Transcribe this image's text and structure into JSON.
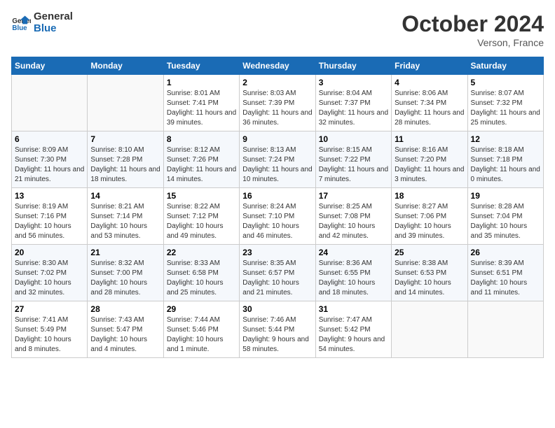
{
  "logo": {
    "line1": "General",
    "line2": "Blue"
  },
  "title": "October 2024",
  "location": "Verson, France",
  "days_header": [
    "Sunday",
    "Monday",
    "Tuesday",
    "Wednesday",
    "Thursday",
    "Friday",
    "Saturday"
  ],
  "weeks": [
    [
      {
        "day": "",
        "info": ""
      },
      {
        "day": "",
        "info": ""
      },
      {
        "day": "1",
        "info": "Sunrise: 8:01 AM\nSunset: 7:41 PM\nDaylight: 11 hours and 39 minutes."
      },
      {
        "day": "2",
        "info": "Sunrise: 8:03 AM\nSunset: 7:39 PM\nDaylight: 11 hours and 36 minutes."
      },
      {
        "day": "3",
        "info": "Sunrise: 8:04 AM\nSunset: 7:37 PM\nDaylight: 11 hours and 32 minutes."
      },
      {
        "day": "4",
        "info": "Sunrise: 8:06 AM\nSunset: 7:34 PM\nDaylight: 11 hours and 28 minutes."
      },
      {
        "day": "5",
        "info": "Sunrise: 8:07 AM\nSunset: 7:32 PM\nDaylight: 11 hours and 25 minutes."
      }
    ],
    [
      {
        "day": "6",
        "info": "Sunrise: 8:09 AM\nSunset: 7:30 PM\nDaylight: 11 hours and 21 minutes."
      },
      {
        "day": "7",
        "info": "Sunrise: 8:10 AM\nSunset: 7:28 PM\nDaylight: 11 hours and 18 minutes."
      },
      {
        "day": "8",
        "info": "Sunrise: 8:12 AM\nSunset: 7:26 PM\nDaylight: 11 hours and 14 minutes."
      },
      {
        "day": "9",
        "info": "Sunrise: 8:13 AM\nSunset: 7:24 PM\nDaylight: 11 hours and 10 minutes."
      },
      {
        "day": "10",
        "info": "Sunrise: 8:15 AM\nSunset: 7:22 PM\nDaylight: 11 hours and 7 minutes."
      },
      {
        "day": "11",
        "info": "Sunrise: 8:16 AM\nSunset: 7:20 PM\nDaylight: 11 hours and 3 minutes."
      },
      {
        "day": "12",
        "info": "Sunrise: 8:18 AM\nSunset: 7:18 PM\nDaylight: 11 hours and 0 minutes."
      }
    ],
    [
      {
        "day": "13",
        "info": "Sunrise: 8:19 AM\nSunset: 7:16 PM\nDaylight: 10 hours and 56 minutes."
      },
      {
        "day": "14",
        "info": "Sunrise: 8:21 AM\nSunset: 7:14 PM\nDaylight: 10 hours and 53 minutes."
      },
      {
        "day": "15",
        "info": "Sunrise: 8:22 AM\nSunset: 7:12 PM\nDaylight: 10 hours and 49 minutes."
      },
      {
        "day": "16",
        "info": "Sunrise: 8:24 AM\nSunset: 7:10 PM\nDaylight: 10 hours and 46 minutes."
      },
      {
        "day": "17",
        "info": "Sunrise: 8:25 AM\nSunset: 7:08 PM\nDaylight: 10 hours and 42 minutes."
      },
      {
        "day": "18",
        "info": "Sunrise: 8:27 AM\nSunset: 7:06 PM\nDaylight: 10 hours and 39 minutes."
      },
      {
        "day": "19",
        "info": "Sunrise: 8:28 AM\nSunset: 7:04 PM\nDaylight: 10 hours and 35 minutes."
      }
    ],
    [
      {
        "day": "20",
        "info": "Sunrise: 8:30 AM\nSunset: 7:02 PM\nDaylight: 10 hours and 32 minutes."
      },
      {
        "day": "21",
        "info": "Sunrise: 8:32 AM\nSunset: 7:00 PM\nDaylight: 10 hours and 28 minutes."
      },
      {
        "day": "22",
        "info": "Sunrise: 8:33 AM\nSunset: 6:58 PM\nDaylight: 10 hours and 25 minutes."
      },
      {
        "day": "23",
        "info": "Sunrise: 8:35 AM\nSunset: 6:57 PM\nDaylight: 10 hours and 21 minutes."
      },
      {
        "day": "24",
        "info": "Sunrise: 8:36 AM\nSunset: 6:55 PM\nDaylight: 10 hours and 18 minutes."
      },
      {
        "day": "25",
        "info": "Sunrise: 8:38 AM\nSunset: 6:53 PM\nDaylight: 10 hours and 14 minutes."
      },
      {
        "day": "26",
        "info": "Sunrise: 8:39 AM\nSunset: 6:51 PM\nDaylight: 10 hours and 11 minutes."
      }
    ],
    [
      {
        "day": "27",
        "info": "Sunrise: 7:41 AM\nSunset: 5:49 PM\nDaylight: 10 hours and 8 minutes."
      },
      {
        "day": "28",
        "info": "Sunrise: 7:43 AM\nSunset: 5:47 PM\nDaylight: 10 hours and 4 minutes."
      },
      {
        "day": "29",
        "info": "Sunrise: 7:44 AM\nSunset: 5:46 PM\nDaylight: 10 hours and 1 minute."
      },
      {
        "day": "30",
        "info": "Sunrise: 7:46 AM\nSunset: 5:44 PM\nDaylight: 9 hours and 58 minutes."
      },
      {
        "day": "31",
        "info": "Sunrise: 7:47 AM\nSunset: 5:42 PM\nDaylight: 9 hours and 54 minutes."
      },
      {
        "day": "",
        "info": ""
      },
      {
        "day": "",
        "info": ""
      }
    ]
  ]
}
